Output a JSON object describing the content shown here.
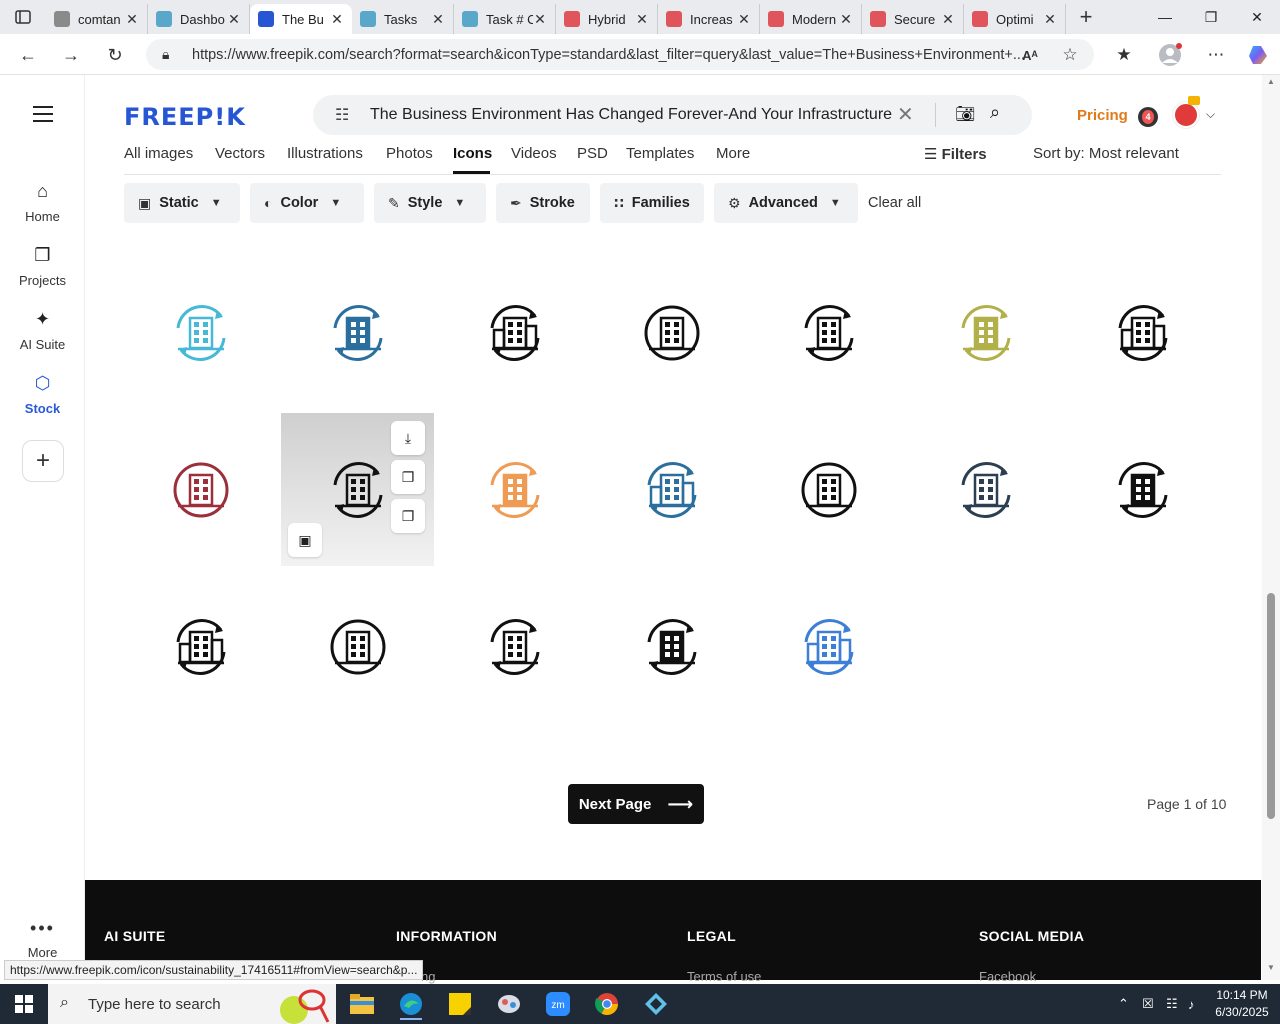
{
  "browser": {
    "tabs": [
      {
        "label": "comtan",
        "color": "#8a8a8a",
        "active": false
      },
      {
        "label": "Dashbo",
        "color": "#5aa8c9",
        "active": false
      },
      {
        "label": "The Bu",
        "color": "#2656d4",
        "active": true
      },
      {
        "label": "Tasks",
        "color": "#5aa8c9",
        "active": false
      },
      {
        "label": "Task # C",
        "color": "#5aa8c9",
        "active": false
      },
      {
        "label": "Hybrid",
        "color": "#e0555c",
        "active": false
      },
      {
        "label": "Increas",
        "color": "#e0555c",
        "active": false
      },
      {
        "label": "Modern",
        "color": "#e0555c",
        "active": false
      },
      {
        "label": "Secure",
        "color": "#e0555c",
        "active": false
      },
      {
        "label": "Optimi",
        "color": "#e0555c",
        "active": false
      }
    ],
    "url": "https://www.freepik.com/search?format=search&iconType=standard&last_filter=query&last_value=The+Business+Environment+..."
  },
  "sidebar": {
    "items": [
      {
        "label": "Home",
        "icon": "home-icon"
      },
      {
        "label": "Projects",
        "icon": "folder-icon"
      },
      {
        "label": "AI Suite",
        "icon": "sparkle-icon"
      },
      {
        "label": "Stock",
        "icon": "stock-icon"
      }
    ],
    "more_label": "More"
  },
  "header": {
    "logo": "FREEP!K",
    "search_query": "The Business Environment Has Changed Forever-And Your Infrastructure",
    "pricing": "Pricing",
    "notifications": "4"
  },
  "category_tabs": [
    "All images",
    "Vectors",
    "Illustrations",
    "Photos",
    "Icons",
    "Videos",
    "PSD",
    "Templates",
    "More"
  ],
  "filters_label": "Filters",
  "sort_label": "Sort by:",
  "sort_value": "Most relevant",
  "filter_chips": [
    {
      "label": "Static",
      "icon": "static-icon",
      "caret": true
    },
    {
      "label": "Color",
      "icon": "palette-icon",
      "caret": true
    },
    {
      "label": "Style",
      "icon": "brush-icon",
      "caret": true
    },
    {
      "label": "Stroke",
      "icon": "pen-icon",
      "caret": false
    },
    {
      "label": "Families",
      "icon": "grid-icon",
      "caret": false
    },
    {
      "label": "Advanced",
      "icon": "gear-icon",
      "caret": true
    }
  ],
  "clear_all": "Clear all",
  "icons": [
    {
      "name": "city-globe-icon",
      "color": "#45b9d6"
    },
    {
      "name": "building-globe-icon",
      "color": "#2a6f9e"
    },
    {
      "name": "building-arrows-icon",
      "color": "#111111"
    },
    {
      "name": "city-platform-icon",
      "color": "#111111"
    },
    {
      "name": "building-cycle-icon",
      "color": "#111111"
    },
    {
      "name": "building-refresh-icon",
      "color": "#b1b049"
    },
    {
      "name": "building-hand-gear-icon",
      "color": "#111111"
    },
    {
      "name": "buildings-cycle-red-icon",
      "color": "#9b2f3a"
    },
    {
      "name": "sustainability-icon",
      "color": "#111111"
    },
    {
      "name": "buildings-cycle-orange-icon",
      "color": "#f09b54"
    },
    {
      "name": "buildings-transfer-icon",
      "color": "#2a6f9e"
    },
    {
      "name": "building-globe-outline-icon",
      "color": "#111111"
    },
    {
      "name": "buildings-circle-icon",
      "color": "#2c3e50"
    },
    {
      "name": "cloud-network-icon",
      "color": "#111111"
    },
    {
      "name": "network-buildings-icon",
      "color": "#111111"
    },
    {
      "name": "city-cycle-icon",
      "color": "#111111"
    },
    {
      "name": "city-earth-icon",
      "color": "#111111"
    },
    {
      "name": "building-circle-icon",
      "color": "#111111"
    },
    {
      "name": "city-blue-cycle-icon",
      "color": "#3d7fd6"
    }
  ],
  "hover_actions": [
    "download-icon",
    "copy-icon",
    "save-to-folder-icon",
    "edit-image-icon"
  ],
  "pagination": {
    "next_label": "Next Page",
    "page_info": "Page 1 of 10"
  },
  "footer": {
    "columns": [
      "AI SUITE",
      "INFORMATION",
      "LEGAL",
      "SOCIAL MEDIA"
    ],
    "links": [
      "ng",
      "Terms of use",
      "Facebook"
    ]
  },
  "status_url": "https://www.freepik.com/icon/sustainability_17416511#fromView=search&p...",
  "taskbar": {
    "search_placeholder": "Type here to search",
    "time": "10:14 PM",
    "date": "6/30/2025"
  }
}
